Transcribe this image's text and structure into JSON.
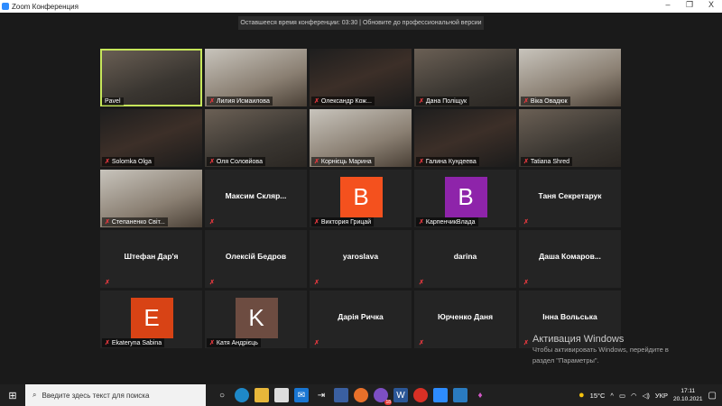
{
  "window": {
    "title": "Zoom Конференция",
    "minimize": "–",
    "maximize": "❐",
    "close": "X"
  },
  "banner": "Оставшееся время конференции: 03:30 | Обновите до профессиональной версии",
  "participants": [
    {
      "name": "Pavel",
      "type": "video",
      "active": true,
      "muted": false
    },
    {
      "name": "Лилия Исмаилова",
      "type": "video"
    },
    {
      "name": "Олександр Кож...",
      "type": "video"
    },
    {
      "name": "Дана Поліщук",
      "type": "video"
    },
    {
      "name": "Віка Овадюк",
      "type": "video"
    },
    {
      "name": "Solomka Olga",
      "type": "video"
    },
    {
      "name": "Оля Соловйова",
      "type": "video"
    },
    {
      "name": "Корнієць Марина",
      "type": "video"
    },
    {
      "name": "Галина Кундеева",
      "type": "video"
    },
    {
      "name": "Tatiana Shred",
      "type": "video"
    },
    {
      "name": "Степаненко Світ...",
      "type": "video"
    },
    {
      "name": "Максим  Скляр...",
      "type": "text"
    },
    {
      "name": "Виктория Грицай",
      "type": "avatar",
      "letter": "В",
      "color": "#f4511e"
    },
    {
      "name": "КарпенчикВлада",
      "type": "avatar",
      "letter": "В",
      "color": "#8e24aa"
    },
    {
      "name": "Таня Секретарук",
      "type": "text"
    },
    {
      "name": "Штефан Дар'я",
      "type": "text"
    },
    {
      "name": "Олексій Бедров",
      "type": "text"
    },
    {
      "name": "yaroslava",
      "type": "text"
    },
    {
      "name": "darina",
      "type": "text"
    },
    {
      "name": "Даша  Комаров...",
      "type": "text"
    },
    {
      "name": "Ekateryna Sabina",
      "type": "avatar",
      "letter": "E",
      "color": "#d84315"
    },
    {
      "name": "Катя Андрієць",
      "type": "avatar",
      "letter": "K",
      "color": "#6d4c41"
    },
    {
      "name": "Дарія Ричка",
      "type": "text"
    },
    {
      "name": "Юрченко Даня",
      "type": "text"
    },
    {
      "name": "Інна Вольська",
      "type": "text"
    }
  ],
  "activation": {
    "title": "Активация Windows",
    "line1": "Чтобы активировать Windows, перейдите в",
    "line2": "раздел \"Параметры\"."
  },
  "taskbar": {
    "search_placeholder": "Введите здесь текст для поиска",
    "temperature": "15°C",
    "language": "УКР",
    "time": "17:11",
    "date": "20.10.2021",
    "viber_badge": "18"
  }
}
